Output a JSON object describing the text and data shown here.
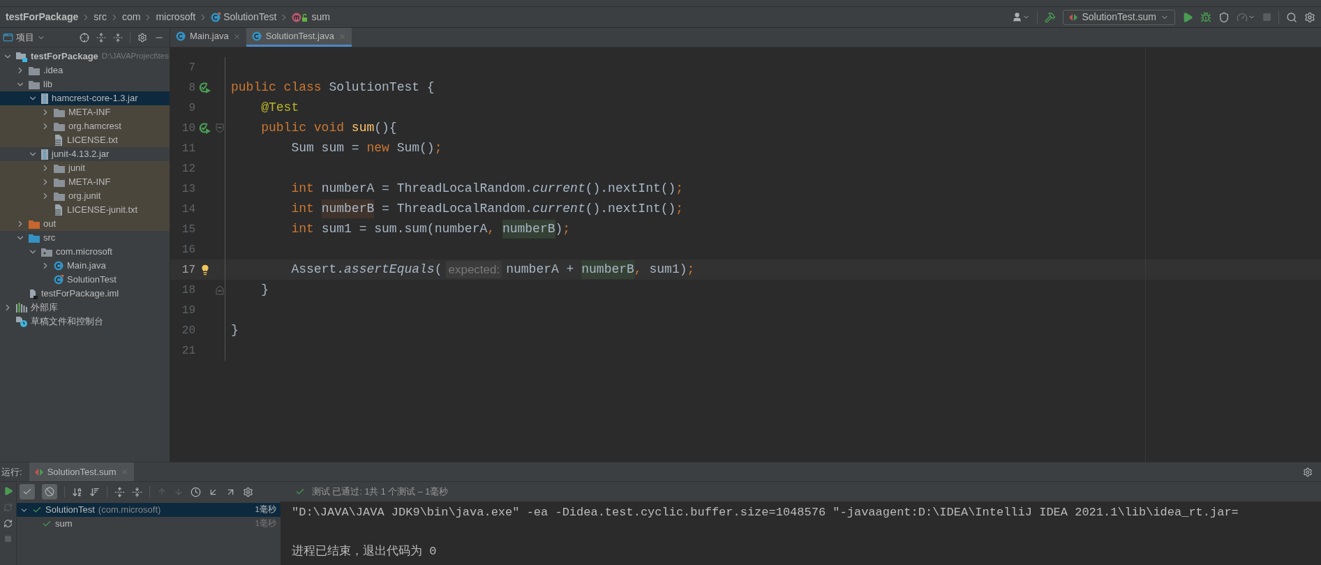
{
  "breadcrumb": [
    {
      "text": "testForPackage",
      "kind": "project"
    },
    {
      "text": "src",
      "kind": "dir"
    },
    {
      "text": "com",
      "kind": "dir"
    },
    {
      "text": "microsoft",
      "kind": "dir"
    },
    {
      "text": "SolutionTest",
      "kind": "class"
    },
    {
      "text": "sum",
      "kind": "method"
    }
  ],
  "run_config": {
    "label": "SolutionTest.sum"
  },
  "project_panel": {
    "title": "项目",
    "tree": [
      {
        "label": "testForPackage",
        "detail": "D:\\JAVAProject\\tes",
        "kind": "project",
        "expanded": true,
        "selected": false,
        "tinted": false,
        "children": [
          {
            "label": ".idea",
            "kind": "folder",
            "expanded": false,
            "selected": false,
            "tinted": false
          },
          {
            "label": "lib",
            "kind": "folder",
            "expanded": true,
            "selected": false,
            "tinted": false,
            "children": [
              {
                "label": "hamcrest-core-1.3.jar",
                "kind": "jar",
                "expanded": true,
                "selected": true,
                "children": [
                  {
                    "label": "META-INF",
                    "kind": "folder",
                    "expanded": false,
                    "selected": false,
                    "tinted": true
                  },
                  {
                    "label": "org.hamcrest",
                    "kind": "folder",
                    "expanded": false,
                    "selected": false,
                    "tinted": true
                  },
                  {
                    "label": "LICENSE.txt",
                    "kind": "text",
                    "selected": false,
                    "tinted": true
                  }
                ]
              },
              {
                "label": "junit-4.13.2.jar",
                "kind": "jar",
                "expanded": true,
                "selected": false,
                "tinted": false,
                "children": [
                  {
                    "label": "junit",
                    "kind": "folder",
                    "expanded": false,
                    "selected": false,
                    "tinted": true
                  },
                  {
                    "label": "META-INF",
                    "kind": "folder",
                    "expanded": false,
                    "selected": false,
                    "tinted": true
                  },
                  {
                    "label": "org.junit",
                    "kind": "folder",
                    "expanded": false,
                    "selected": false,
                    "tinted": true
                  },
                  {
                    "label": "LICENSE-junit.txt",
                    "kind": "text",
                    "selected": false,
                    "tinted": true
                  }
                ]
              }
            ]
          },
          {
            "label": "out",
            "kind": "excluded",
            "expanded": false,
            "selected": false,
            "tinted": true
          },
          {
            "label": "src",
            "kind": "source",
            "expanded": true,
            "selected": false,
            "tinted": false,
            "children": [
              {
                "label": "com.microsoft",
                "kind": "package",
                "expanded": true,
                "selected": false,
                "tinted": false,
                "children": [
                  {
                    "label": "Main.java",
                    "kind": "class",
                    "expanded": false,
                    "selected": false,
                    "tinted": false
                  },
                  {
                    "label": "SolutionTest",
                    "kind": "test-class",
                    "selected": false,
                    "tinted": false
                  }
                ]
              }
            ]
          },
          {
            "label": "testForPackage.iml",
            "kind": "iml",
            "selected": false,
            "tinted": false
          }
        ]
      },
      {
        "label": "外部库",
        "kind": "libraries",
        "expanded": false,
        "selected": false,
        "tinted": false
      },
      {
        "label": "草稿文件和控制台",
        "kind": "scratches",
        "selected": false,
        "tinted": false
      }
    ]
  },
  "editor_tabs": [
    {
      "label": "Main.java",
      "selected": false
    },
    {
      "label": "SolutionTest.java",
      "selected": true
    }
  ],
  "code": [
    {
      "number": "7",
      "current": false
    },
    {
      "number": "8",
      "current": false,
      "gutter_icon": {
        "kind": "run"
      },
      "tokens": [
        {
          "kind": "keyword",
          "text": "public class"
        },
        {
          "kind": "text",
          "text": " SolutionTest {"
        }
      ]
    },
    {
      "number": "9",
      "current": false,
      "tokens": [
        {
          "kind": "annotation",
          "text": "    @Test"
        }
      ]
    },
    {
      "number": "10",
      "current": false,
      "gutter_icon": {
        "kind": "run"
      },
      "fold": {
        "kind": "start"
      },
      "tokens": [
        {
          "kind": "keyword",
          "text": "    public void "
        },
        {
          "kind": "method",
          "text": "sum"
        },
        {
          "kind": "text",
          "text": "(){"
        }
      ]
    },
    {
      "number": "11",
      "current": false,
      "tokens": [
        {
          "kind": "text",
          "text": "        Sum sum = "
        },
        {
          "kind": "keyword",
          "text": "new"
        },
        {
          "kind": "text",
          "text": " Sum()"
        },
        {
          "kind": "punct",
          "text": ";"
        }
      ]
    },
    {
      "number": "12",
      "current": false
    },
    {
      "number": "13",
      "current": false,
      "tokens": [
        {
          "kind": "keyword",
          "text": "        int"
        },
        {
          "kind": "text",
          "text": " numberA = ThreadLocalRandom."
        },
        {
          "kind": "static",
          "text": "current"
        },
        {
          "kind": "text",
          "text": "().nextInt()"
        },
        {
          "kind": "punct",
          "text": ";"
        }
      ]
    },
    {
      "number": "14",
      "current": false,
      "tokens": [
        {
          "kind": "keyword",
          "text": "        int "
        },
        {
          "kind": "write",
          "text": "numberB"
        },
        {
          "kind": "text",
          "text": " = ThreadLocalRandom."
        },
        {
          "kind": "static",
          "text": "current"
        },
        {
          "kind": "text",
          "text": "().nextInt()"
        },
        {
          "kind": "punct",
          "text": ";"
        }
      ]
    },
    {
      "number": "15",
      "current": false,
      "tokens": [
        {
          "kind": "keyword",
          "text": "        int"
        },
        {
          "kind": "text",
          "text": " sum1 = sum.sum(numberA"
        },
        {
          "kind": "punct",
          "text": ", "
        },
        {
          "kind": "read",
          "text": "numberB"
        },
        {
          "kind": "text",
          "text": ")"
        },
        {
          "kind": "punct",
          "text": ";"
        }
      ]
    },
    {
      "number": "16",
      "current": false
    },
    {
      "number": "17",
      "current": true,
      "gutter_icon": {
        "kind": "bulb"
      },
      "tokens": [
        {
          "kind": "text",
          "text": "        Assert."
        },
        {
          "kind": "static",
          "text": "assertEquals"
        },
        {
          "kind": "text",
          "text": "("
        },
        {
          "kind": "hint",
          "text": "expected:"
        },
        {
          "kind": "text",
          "text": "numberA + "
        },
        {
          "kind": "read",
          "text": "numberB"
        },
        {
          "kind": "punct",
          "text": ","
        },
        {
          "kind": "text",
          "text": " sum1)"
        },
        {
          "kind": "punct",
          "text": ";"
        }
      ]
    },
    {
      "number": "18",
      "current": false,
      "fold": {
        "kind": "end"
      },
      "tokens": [
        {
          "kind": "text",
          "text": "    }"
        }
      ]
    },
    {
      "number": "19",
      "current": false
    },
    {
      "number": "20",
      "current": false,
      "tokens": [
        {
          "kind": "text",
          "text": "}"
        }
      ]
    },
    {
      "number": "21",
      "current": false
    }
  ],
  "run_panel": {
    "label": "运行:",
    "tab": "SolutionTest.sum",
    "toggles": [
      {
        "kind": "passed",
        "on": true
      },
      {
        "kind": "ignored",
        "on": true
      }
    ],
    "status": "测试 已通过: 1共 1 个测试 – 1毫秒",
    "tests": [
      {
        "name": "SolutionTest",
        "detail": "(com.microsoft)",
        "time": "1毫秒",
        "selected": true,
        "passed": true,
        "children": [
          {
            "name": "sum",
            "time": "1毫秒",
            "selected": false,
            "passed": true
          }
        ]
      }
    ],
    "console": [
      {
        "text": "\"D:\\JAVA\\JAVA JDK9\\bin\\java.exe\" -ea -Didea.test.cyclic.buffer.size=1048576 \"-javaagent:D:\\IDEA\\IntelliJ IDEA 2021.1\\lib\\idea_rt.jar="
      },
      {
        "text": "进程已结束，退出代码为 0"
      }
    ]
  }
}
